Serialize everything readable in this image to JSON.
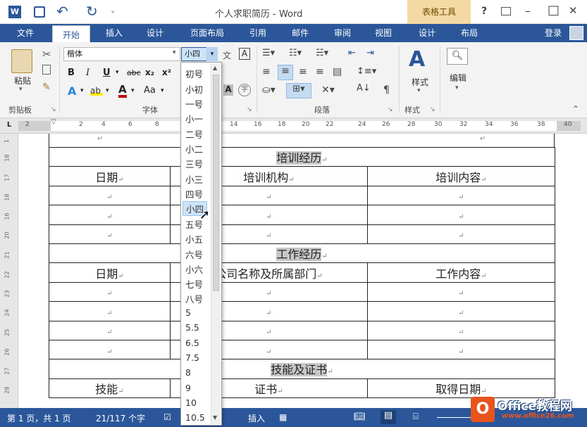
{
  "title_bar": {
    "doc_title": "个人求职简历 - Word",
    "context_tab_group": "表格工具",
    "help": "?",
    "minimize": "–",
    "restore": "□",
    "close": "✕"
  },
  "ribbon_tabs": [
    "文件",
    "开始",
    "插入",
    "设计",
    "页面布局",
    "引用",
    "邮件",
    "审阅",
    "视图",
    "设计",
    "布局"
  ],
  "login_label": "登录",
  "ribbon": {
    "clipboard": {
      "paste": "粘贴",
      "group": "剪贴板"
    },
    "font": {
      "font_name": "楷体",
      "font_size": "小四",
      "bold": "B",
      "italic": "I",
      "underline": "U",
      "strike": "abc",
      "subscript": "x₂",
      "superscript": "x²",
      "change_case": "Aa",
      "group": "字体",
      "wen": "文",
      "a_box": "A"
    },
    "paragraph": {
      "group": "段落"
    },
    "styles": {
      "label": "样式",
      "group": "样式"
    },
    "editing": {
      "label": "编辑"
    }
  },
  "ruler_ticks": [
    "2",
    "2",
    "4",
    "6",
    "8",
    "10",
    "14",
    "16",
    "18",
    "20",
    "22",
    "24",
    "26",
    "28",
    "30",
    "32",
    "34",
    "36",
    "38",
    "40"
  ],
  "vruler_ticks": [
    "1",
    "18",
    "17",
    "18",
    "16",
    "20",
    "21",
    "22",
    "23",
    "24",
    "25",
    "26",
    "27",
    "28"
  ],
  "font_size_dropdown": {
    "items": [
      "初号",
      "小初",
      "一号",
      "小一",
      "二号",
      "小二",
      "三号",
      "小三",
      "四号",
      "小四",
      "五号",
      "小五",
      "六号",
      "小六",
      "七号",
      "八号",
      "5",
      "5.5",
      "6.5",
      "7.5",
      "8",
      "9",
      "10",
      "10.5"
    ],
    "selected": "小四"
  },
  "resume_table": {
    "training_header": "培训经历",
    "training_cols": [
      "日期",
      "培训机构",
      "培训内容"
    ],
    "work_header": "工作经历",
    "work_cols": [
      "日期",
      "公司名称及所属部门",
      "工作内容"
    ],
    "skills_header": "技能及证书",
    "skills_cols": [
      "技能",
      "证书",
      "取得日期"
    ],
    "para_mark": "↵"
  },
  "status_bar": {
    "page": "第 1 页，共 1 页",
    "words": "21/117 个字",
    "mode": "插入"
  },
  "watermark": {
    "main": "Office教程网",
    "sub": "www.office26.com"
  },
  "colors": {
    "accent": "#2b579a",
    "context_tab": "#f3d9a3",
    "selection": "#cde3f7"
  }
}
